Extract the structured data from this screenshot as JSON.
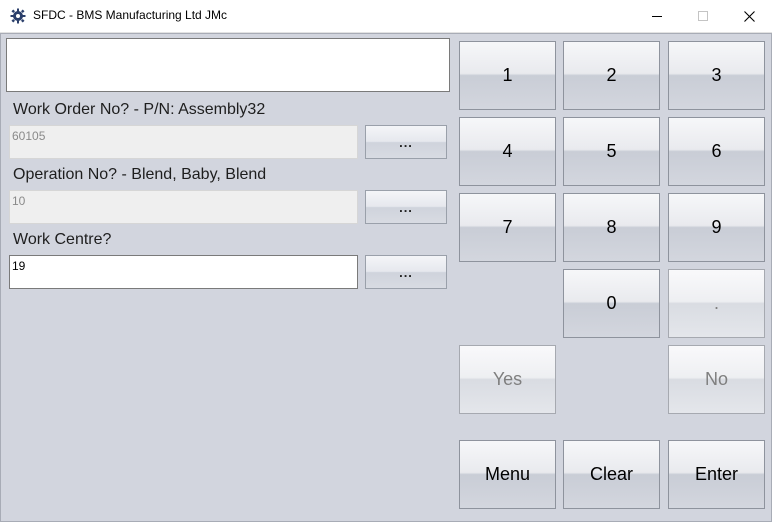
{
  "window": {
    "title": "SFDC - BMS Manufacturing Ltd JMc",
    "icon": "gear-app-icon",
    "controls": [
      "minimize-icon",
      "maximize-icon",
      "close-icon"
    ]
  },
  "message": "",
  "form": {
    "work_order": {
      "label": "Work Order No? - P/N: Assembly32",
      "value": "60105",
      "browse_label": "..."
    },
    "operation": {
      "label": "Operation No? - Blend, Baby, Blend",
      "value": "10",
      "browse_label": "..."
    },
    "work_centre": {
      "label": "Work Centre?",
      "value": "19",
      "browse_label": "..."
    }
  },
  "keypad": {
    "k1": "1",
    "k2": "2",
    "k3": "3",
    "k4": "4",
    "k5": "5",
    "k6": "6",
    "k7": "7",
    "k8": "8",
    "k9": "9",
    "k0": "0",
    "dot": ".",
    "yes": "Yes",
    "no": "No",
    "menu": "Menu",
    "clear": "Clear",
    "enter": "Enter"
  },
  "colors": {
    "background": "#d2d5de",
    "button_face": "#e9eaee",
    "disabled_text": "#7f7f7f"
  }
}
